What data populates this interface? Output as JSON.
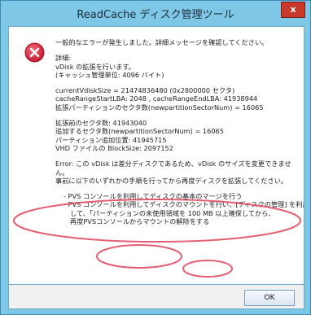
{
  "window": {
    "title": "ReadCache ディスク管理ツール",
    "close_label": "x"
  },
  "icon": "error-icon",
  "message": {
    "l01": "一般的なエラーが発生しました。詳細メッセージを確認してください。",
    "l02": "詳細:",
    "l03": "vDisk の拡張を行います。",
    "l04": "(キャッシュ管理単位: 4096 バイト)",
    "l05": "currentVdiskSize = 21474836480 (0x2800000 セクタ)",
    "l06": "cacheRangeStartLBA: 2048 , cacheRangeEndLBA: 41938944",
    "l07": "拡張パーティションのセクタ数(newpartitionSectorNum) = 16065",
    "l08": "拡張前のセクタ数: 41943040",
    "l09": "追加するセクタ数(newpartitionSectorNum) = 16065",
    "l10": "パーティション追加位置: 41945715",
    "l11": "VHD ファイルの BlockSize: 2097152",
    "l12": "Error: この vDisk は差分ディスクであるため、vDisk のサイズを変更できませ",
    "l13": "ん。",
    "l14": "事前に以下のいずれかの手順を行ってから再度ディスクを拡張してください。",
    "l15": "- PVS コンソールを利用してディスクの基本のマージを行う",
    "l16": "- PVS コンソールを利用してディスクのマウントを行い、[ディスクの管理] を利用",
    "l17": "して、「パーティションの未使用領域を 100 MB 以上確保してから、",
    "l18": "再度PVSコンソールからマウントの解除をする"
  },
  "footer": {
    "ok_label": "OK"
  },
  "colors": {
    "frame": "#7fc7e6",
    "close": "#c6392b",
    "annotation": "#e0435a",
    "error_icon": "#d7263d"
  }
}
